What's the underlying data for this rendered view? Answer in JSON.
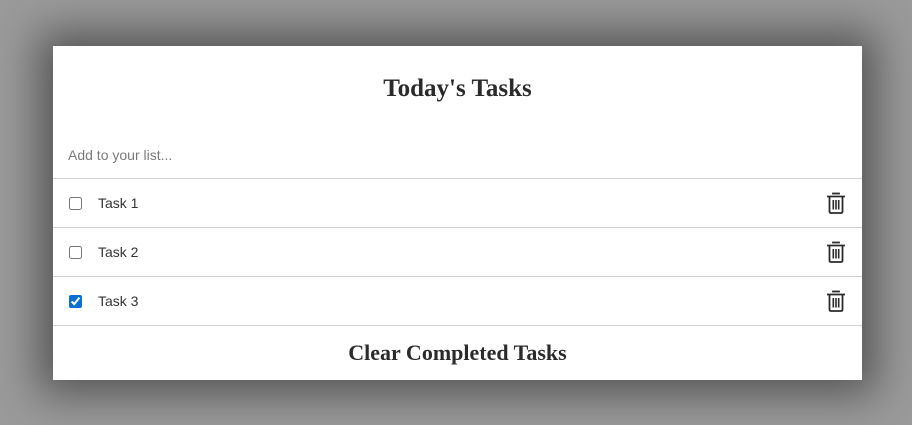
{
  "app": {
    "title": "Today's Tasks"
  },
  "add_input": {
    "placeholder": "Add to your list...",
    "value": ""
  },
  "tasks": [
    {
      "label": "Task 1",
      "completed": false
    },
    {
      "label": "Task 2",
      "completed": false
    },
    {
      "label": "Task 3",
      "completed": true
    }
  ],
  "footer": {
    "clear_label": "Clear Completed Tasks"
  },
  "icons": {
    "delete": "trash-icon"
  },
  "colors": {
    "background": "#9a9a9a",
    "card": "#ffffff",
    "text": "#2b2b2b",
    "divider": "#d0d0d0",
    "checkbox_accent": "#0b6fd6"
  }
}
